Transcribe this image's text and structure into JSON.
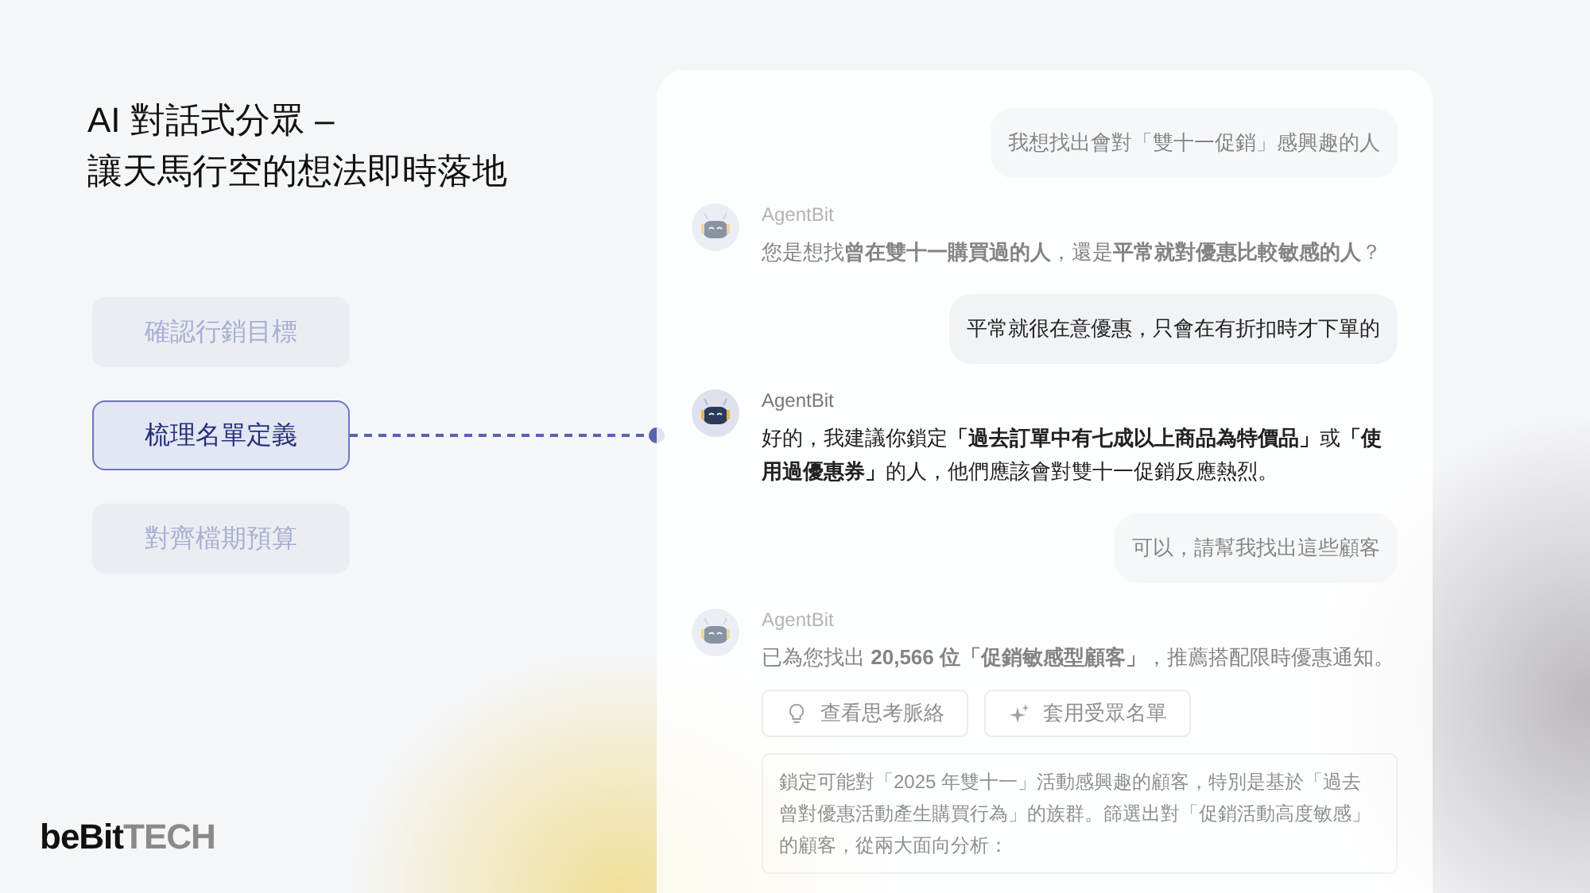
{
  "title": {
    "line_1": "AI 對話式分眾 –",
    "line_2": "讓天馬行空的想法即時落地"
  },
  "steps": [
    {
      "label": "確認行銷目標",
      "selected": false
    },
    {
      "label": "梳理名單定義",
      "selected": true
    },
    {
      "label": "對齊檔期預算",
      "selected": false
    }
  ],
  "chat": {
    "messages": [
      {
        "kind": "user",
        "text": "我想找出會對「雙十一促銷」感興趣的人",
        "dimmed": true
      },
      {
        "kind": "agent",
        "name": "AgentBit",
        "text": "您是想找**曾在雙十一購買過的人**，還是**平常就對優惠比較敏感的人**？",
        "dimmed": true
      },
      {
        "kind": "user",
        "text": "平常就很在意優惠，只會在有折扣時才下單的",
        "dimmed": false
      },
      {
        "kind": "agent",
        "name": "AgentBit",
        "text": "好的，我建議你鎖定**「過去訂單中有七成以上商品為特價品」**或**「使用過優惠券」**的人，他們應該會對雙十一促銷反應熱烈。",
        "dimmed": false
      },
      {
        "kind": "user",
        "text": "可以，請幫我找出這些顧客",
        "dimmed": true
      },
      {
        "kind": "agent",
        "name": "AgentBit",
        "text": "已為您找出 **20,566 位「促銷敏感型顧客」**，推薦搭配限時優惠通知。",
        "dimmed": true,
        "buttons": [
          "查看思考脈絡",
          "套用受眾名單"
        ],
        "reasoning": "鎖定可能對「2025 年雙十一」活動感興趣的顧客，特別是基於「過去曾對優惠活動產生購買行為」的族群。篩選出對「促銷活動高度敏感」的顧客，從兩大面向分析："
      }
    ]
  },
  "logo": {
    "brand": "beBit",
    "suffix": "TECH"
  }
}
